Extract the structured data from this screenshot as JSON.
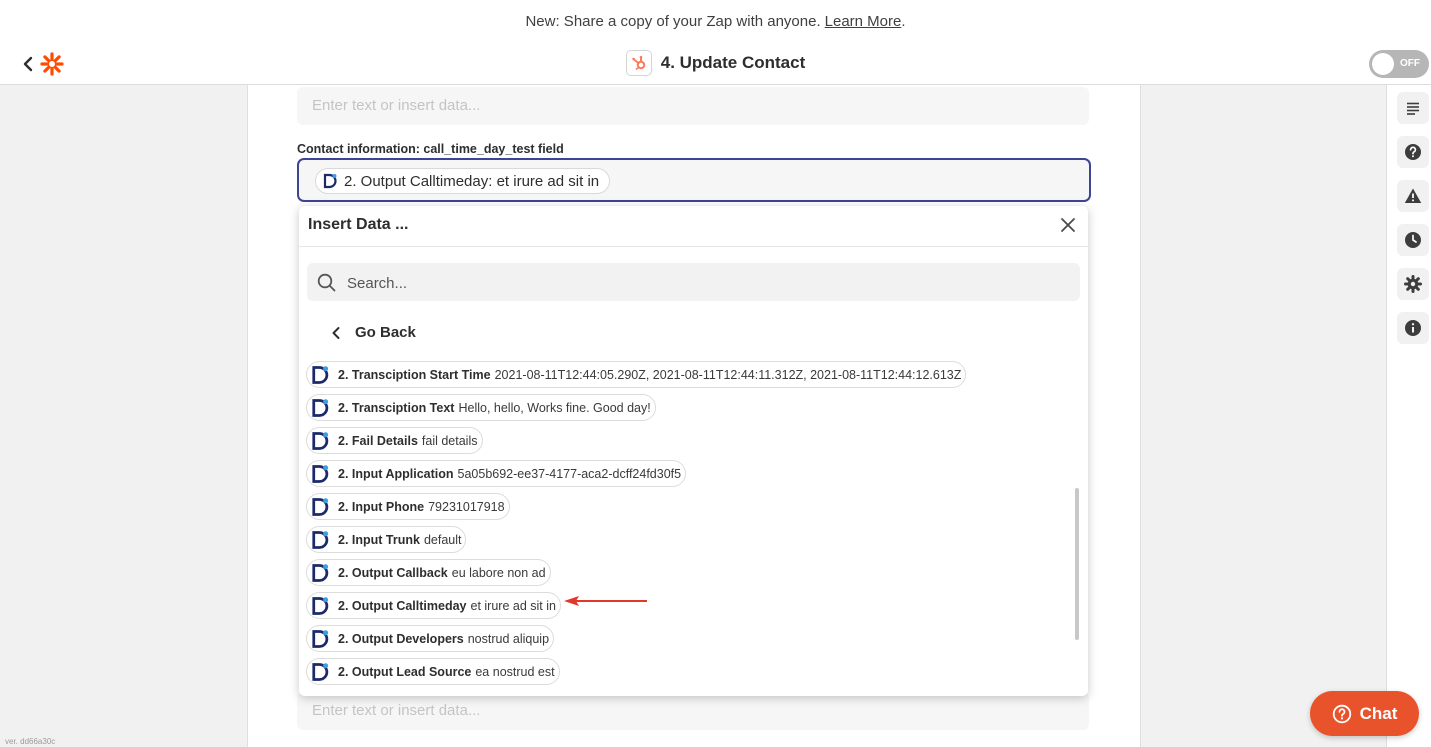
{
  "banner": {
    "text": "New: Share a copy of your Zap with anyone.",
    "link": "Learn More",
    "suffix": "."
  },
  "header": {
    "title": "4. Update Contact",
    "toggle_label": "OFF"
  },
  "form": {
    "top_field_placeholder": "Enter text or insert data...",
    "field_label": "Contact information: call_time_day_test field",
    "field_token": "2. Output Calltimeday: et irure ad sit in",
    "bottom_field_placeholder": "Enter text or insert data..."
  },
  "dropdown": {
    "title": "Insert Data ...",
    "search_placeholder": "Search...",
    "go_back": "Go Back",
    "items": [
      {
        "name": "2. Transciption Start Time",
        "value": "2021-08-11T12:44:05.290Z, 2021-08-11T12:44:11.312Z, 2021-08-11T12:44:12.613Z"
      },
      {
        "name": "2. Transciption Text",
        "value": "Hello, hello, Works fine. Good day!"
      },
      {
        "name": "2. Fail Details",
        "value": "fail details"
      },
      {
        "name": "2. Input Application",
        "value": "5a05b692-ee37-4177-aca2-dcff24fd30f5"
      },
      {
        "name": "2. Input Phone",
        "value": "79231017918"
      },
      {
        "name": "2. Input Trunk",
        "value": "default"
      },
      {
        "name": "2. Output Callback",
        "value": "eu labore non ad"
      },
      {
        "name": "2. Output Calltimeday",
        "value": "et irure ad sit in"
      },
      {
        "name": "2. Output Developers",
        "value": "nostrud aliquip"
      },
      {
        "name": "2. Output Lead Source",
        "value": "ea nostrud est"
      }
    ]
  },
  "sidebar_icons": [
    "list-icon",
    "help-icon",
    "warning-icon",
    "history-icon",
    "settings-icon",
    "info-icon"
  ],
  "chat": {
    "label": "Chat"
  },
  "version": "ver. dd66a30c",
  "colors": {
    "accent": "#e8532c",
    "focus_border": "#3d4592",
    "annotation_arrow": "#e0382a"
  }
}
